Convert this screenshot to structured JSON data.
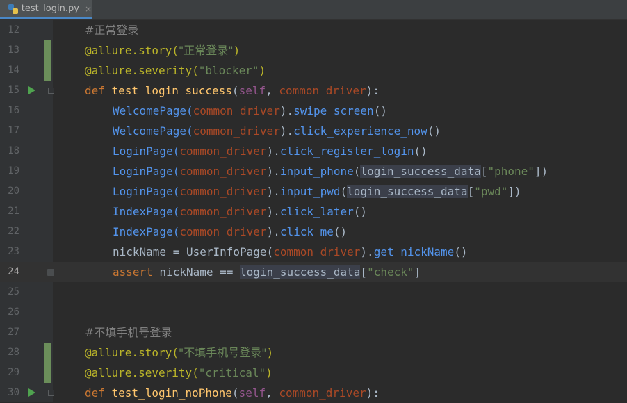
{
  "tab": {
    "file_name": "test_login.py",
    "close_glyph": "×"
  },
  "colors": {
    "background": "#2b2b2b",
    "gutter": "#313335",
    "comment": "#808080",
    "decorator": "#bbb529",
    "string": "#6a8759",
    "keyword": "#cc7832",
    "function_name": "#ffc66d",
    "self_param": "#94558d",
    "parameter": "#aa4926",
    "method_call": "#5394ec",
    "vcs_added": "#6b8e5a",
    "run_icon": "#4fa34f"
  },
  "editor": {
    "current_line": "24",
    "lines": [
      {
        "num": "12",
        "t1": "#正常登录"
      },
      {
        "num": "13",
        "t1": "@allure.story(",
        "t2": "\"正常登录\"",
        "t3": ")"
      },
      {
        "num": "14",
        "t1": "@allure.severity(",
        "t2": "\"blocker\"",
        "t3": ")"
      },
      {
        "num": "15",
        "t1": "def ",
        "t2": "test_login_success",
        "t3": "(",
        "t4": "self",
        "t5": ", ",
        "t6": "common_driver",
        "t7": "):"
      },
      {
        "num": "16",
        "t1": "WelcomePage(",
        "t2": "common_driver",
        "t3": ").",
        "t4": "swipe_screen",
        "t5": "()"
      },
      {
        "num": "17",
        "t1": "WelcomePage(",
        "t2": "common_driver",
        "t3": ").",
        "t4": "click_experience_now",
        "t5": "()"
      },
      {
        "num": "18",
        "t1": "LoginPage(",
        "t2": "common_driver",
        "t3": ").",
        "t4": "click_register_login",
        "t5": "()"
      },
      {
        "num": "19",
        "t1": "LoginPage(",
        "t2": "common_driver",
        "t3": ").",
        "t4": "input_phone",
        "t5": "(",
        "t6": "login_success_data",
        "t7": "[",
        "t8": "\"phone\"",
        "t9": "])"
      },
      {
        "num": "20",
        "t1": "LoginPage(",
        "t2": "common_driver",
        "t3": ").",
        "t4": "input_pwd",
        "t5": "(",
        "t6": "login_success_data",
        "t7": "[",
        "t8": "\"pwd\"",
        "t9": "])"
      },
      {
        "num": "21",
        "t1": "IndexPage(",
        "t2": "common_driver",
        "t3": ").",
        "t4": "click_later",
        "t5": "()"
      },
      {
        "num": "22",
        "t1": "IndexPage(",
        "t2": "common_driver",
        "t3": ").",
        "t4": "click_me",
        "t5": "()"
      },
      {
        "num": "23",
        "t1": "nickName = UserInfoPage(",
        "t2": "common_driver",
        "t3": ").",
        "t4": "get_nickName",
        "t5": "()"
      },
      {
        "num": "24",
        "t1": "assert",
        "t2": " nickName == ",
        "t3": "login_success_data",
        "t4": "[",
        "t5": "\"check\"",
        "t6": "]"
      },
      {
        "num": "25"
      },
      {
        "num": "26"
      },
      {
        "num": "27",
        "t1": "#不填手机号登录"
      },
      {
        "num": "28",
        "t1": "@allure.story(",
        "t2": "\"不填手机号登录\"",
        "t3": ")"
      },
      {
        "num": "29",
        "t1": "@allure.severity(",
        "t2": "\"critical\"",
        "t3": ")"
      },
      {
        "num": "30",
        "t1": "def ",
        "t2": "test_login_noPhone",
        "t3": "(",
        "t4": "self",
        "t5": ", ",
        "t6": "common_driver",
        "t7": "):"
      }
    ]
  }
}
